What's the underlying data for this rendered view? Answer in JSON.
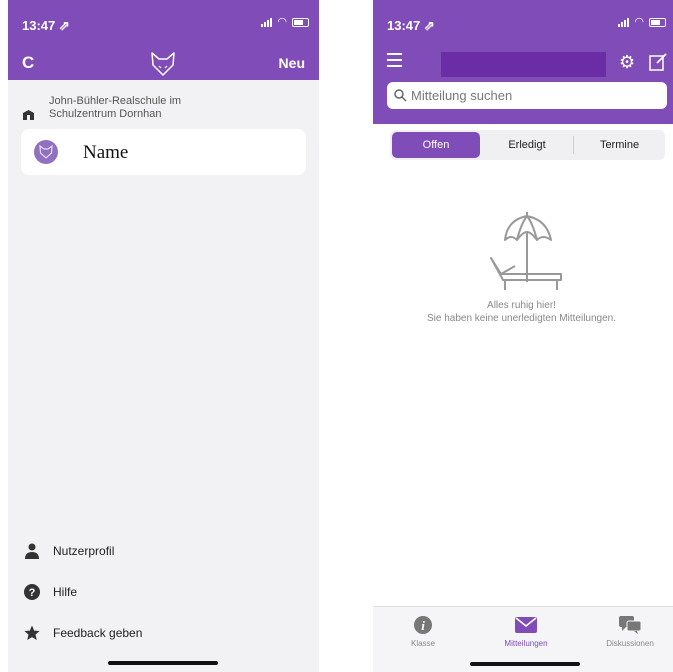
{
  "left": {
    "status": {
      "time": "13:47 ⇗"
    },
    "header": {
      "refresh": "C",
      "new": "Neu"
    },
    "school": {
      "line1": "John-Bühler-Realschule im",
      "line2": "Schulzentrum Dornhan"
    },
    "account": {
      "name": "Name"
    },
    "menu": [
      {
        "label": "Nutzerprofil",
        "icon": "person-icon"
      },
      {
        "label": "Hilfe",
        "icon": "help-icon"
      },
      {
        "label": "Feedback geben",
        "icon": "star-icon"
      }
    ]
  },
  "right": {
    "status": {
      "time": "13:47 ⇗"
    },
    "search": {
      "placeholder": "Mitteilung suchen"
    },
    "segments": {
      "open": "Offen",
      "done": "Erledigt",
      "dates": "Termine"
    },
    "empty": {
      "title": "Alles ruhig hier!",
      "subtitle": "Sie haben keine unerledigten Mitteilungen."
    },
    "tabs": {
      "class": "Klasse",
      "messages": "Mitteilungen",
      "discussions": "Diskussionen"
    }
  },
  "colors": {
    "brand": "#7f4cb8",
    "title_bar": "#6a2da6"
  }
}
